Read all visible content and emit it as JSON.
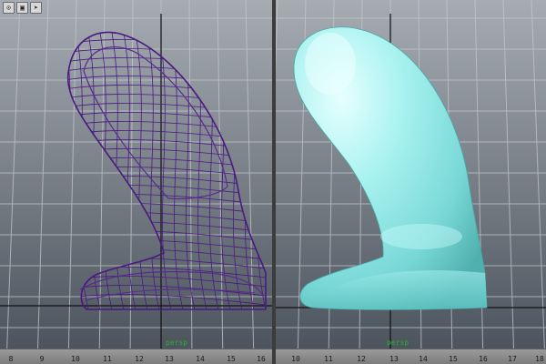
{
  "toolbar": {
    "buttons": [
      {
        "name": "camera-icon",
        "glyph": "⊙"
      },
      {
        "name": "cube-icon",
        "glyph": "▣"
      },
      {
        "name": "arrow-select-icon",
        "glyph": "➤"
      }
    ]
  },
  "left_viewport": {
    "camera_label": "persp",
    "ruler_labels": [
      "8",
      "9",
      "10",
      "11",
      "12",
      "13",
      "14",
      "15",
      "16"
    ],
    "display_mode": "wireframe",
    "wire_color": "#4a1a80"
  },
  "right_viewport": {
    "camera_label": "persp",
    "ruler_labels": [
      "10",
      "11",
      "12",
      "13",
      "14",
      "15",
      "16",
      "17",
      "18"
    ],
    "display_mode": "shaded",
    "surface_color": "#8fe8e6"
  },
  "colors": {
    "background_top": "#a6acb2",
    "background_bottom": "#48505a",
    "grid": "#c4c8cc",
    "axis": "#111111",
    "persp_label": "#2fae2f"
  }
}
